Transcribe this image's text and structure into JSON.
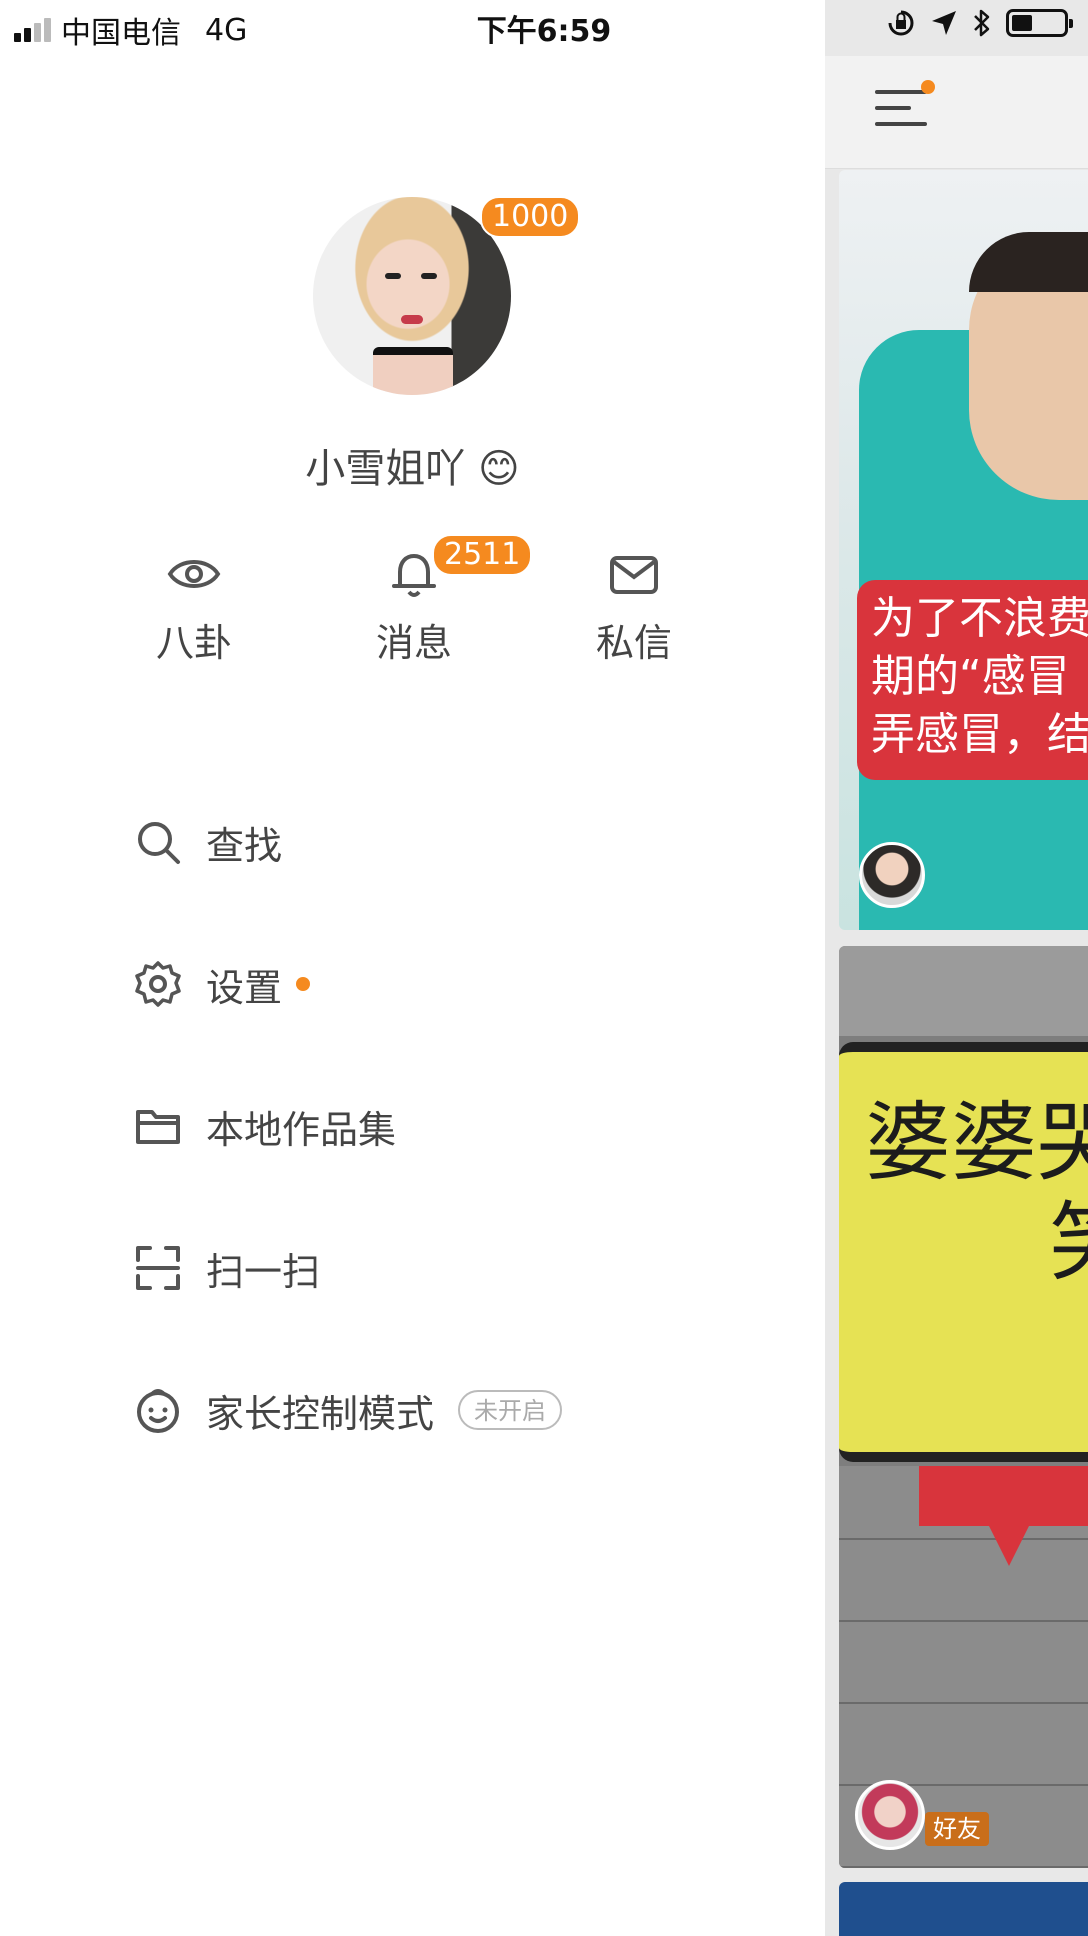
{
  "status_bar": {
    "carrier": "中国电信",
    "network": "4G",
    "time": "下午6:59"
  },
  "profile": {
    "name": "小雪姐吖",
    "avatar_badge": "1000"
  },
  "quick_actions": [
    {
      "label": "八卦",
      "icon": "eye-icon"
    },
    {
      "label": "消息",
      "icon": "bell-icon",
      "badge": "2511"
    },
    {
      "label": "私信",
      "icon": "mail-icon"
    }
  ],
  "menu": [
    {
      "label": "查找",
      "icon": "search-icon"
    },
    {
      "label": "设置",
      "icon": "gear-icon"
    },
    {
      "label": "本地作品集",
      "icon": "folder-icon"
    },
    {
      "label": "扫一扫",
      "icon": "scan-icon"
    },
    {
      "label": "家长控制模式",
      "icon": "child-face-icon",
      "tag": "未开启"
    }
  ],
  "feed": {
    "card1_caption": [
      "为了不浪费",
      "期的“感冒",
      "弄感冒，结"
    ],
    "card2_text_line1": "婆婆哭",
    "card2_text_line2": "笑",
    "card2_tag": "好友"
  },
  "colors": {
    "accent": "#f58a1f",
    "text": "#444444",
    "card_red": "#d9343c",
    "card_yellow": "#e6e254",
    "card_teal": "#2ab9b1"
  }
}
